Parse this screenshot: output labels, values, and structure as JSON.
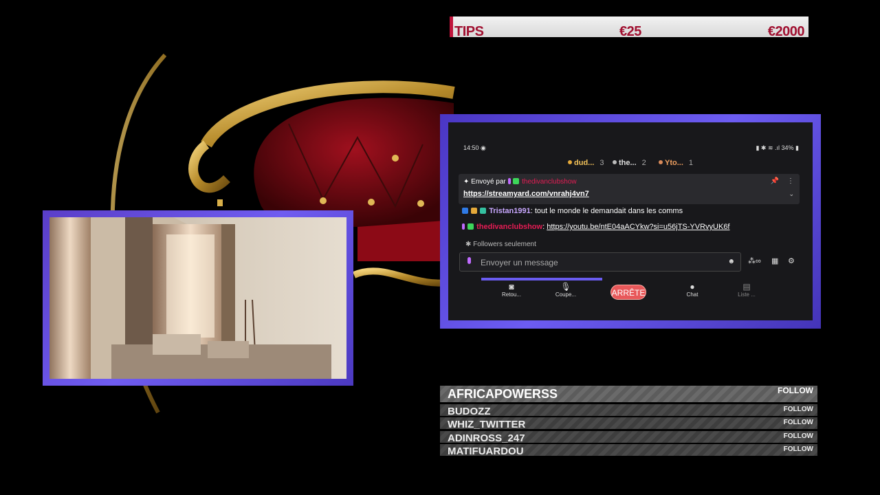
{
  "tips": {
    "label": "TIPS",
    "amount1": "€25",
    "amount2": "€2000"
  },
  "phone": {
    "time": "14:50",
    "status_right": "34%",
    "ranking": [
      {
        "name": "dud...",
        "count": "3",
        "color": "#e5a93a"
      },
      {
        "name": "the...",
        "count": "2",
        "color": "#bbbbbb"
      },
      {
        "name": "Yto...",
        "count": "1",
        "color": "#d98a5a"
      }
    ],
    "pinned": {
      "prefix": "Envoyé par",
      "user": "thedivanclubshow",
      "url": "https://streamyard.com/vnrahj4vn7"
    },
    "messages": [
      {
        "user": "Tristan1991",
        "text": " tout le monde le demandait dans les comms"
      },
      {
        "user": "thedivanclubshow",
        "link": "https://youtu.be/ntE04aACYkw?si=u56jTS-YVRvyUK6f"
      }
    ],
    "followers_only": "Followers seulement",
    "chat_placeholder": "Envoyer un message",
    "nav": {
      "back": "Retou...",
      "mute": "Coupe...",
      "stop": "ARRÊTE",
      "chat": "Chat",
      "list": "Liste ..."
    }
  },
  "follows": {
    "top": {
      "name": "AFRICAPOWERSS",
      "label": "FOLLOW"
    },
    "rows": [
      {
        "name": "BUDOZZ",
        "label": "FOLLOW"
      },
      {
        "name": "WHIZ_TWITTER",
        "label": "FOLLOW"
      },
      {
        "name": "ADINROSS_247",
        "label": "FOLLOW"
      },
      {
        "name": "MATIFUARDOU",
        "label": "FOLLOW"
      }
    ]
  },
  "colors": {
    "frame_accent": "#6c5cf2",
    "tips_red": "#a01030",
    "stop_red": "#e8585a",
    "brand_pink": "#e51c54"
  }
}
